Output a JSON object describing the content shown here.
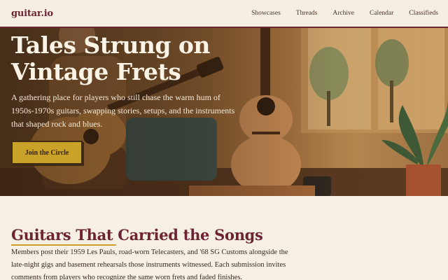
{
  "nav": {
    "brand": "guitar.io",
    "items": [
      "Showcases",
      "Threads",
      "Archive",
      "Calendar",
      "Classifieds"
    ]
  },
  "hero": {
    "title": "Tales Strung on Vintage Frets",
    "description": "A gathering place for players who still chase the warm hum of 1950s-1970s guitars, swapping stories, setups, and the instruments that shaped rock and blues.",
    "cta_label": "Join the Circle"
  },
  "section": {
    "title": "Guitars That Carried the Songs",
    "body": "Members post their 1959 Les Pauls, road-worn Telecasters, and '68 SG Customs alongside the late-night gigs and basement rehearsals those instruments witnessed. Each submission invites comments from players who recognize the same worn frets and faded finishes."
  },
  "colors": {
    "brand": "#6e2333",
    "accent": "#c9a227",
    "background": "#f5efe4"
  }
}
